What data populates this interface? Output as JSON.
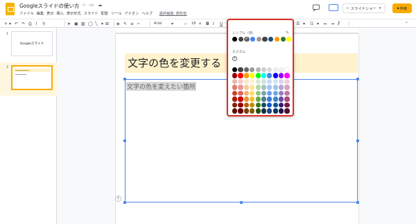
{
  "header": {
    "doc_title": "Googleスライドの使い方",
    "menu": [
      "ファイル",
      "編集",
      "表示",
      "挿入",
      "表示形式",
      "スライド",
      "配置",
      "ツール",
      "アドオン",
      "ヘルプ"
    ],
    "last_edit": "最終編集: 数秒前",
    "slideshow_label": "スライドショー",
    "share_label": "共有",
    "share_color": "#f9ab00"
  },
  "toolbar": {
    "font": "Arial",
    "font_size": "18",
    "text_color_glyph": "A"
  },
  "filmstrip": {
    "slides": [
      {
        "number": "1",
        "title": "Googleスライド"
      },
      {
        "number": "2",
        "title": "文字の色を変更する"
      }
    ]
  },
  "slide": {
    "title": "文字の色を変更する",
    "body": "文字の色を変えたい箇所",
    "title_bg": "#fff2cc"
  },
  "color_picker": {
    "simple_label": "シンプル（単）",
    "pastel_label": "カスタム",
    "simple_colors": [
      "#000000",
      "#434343",
      "#666666",
      "#4285f4",
      "#999999",
      "#434343",
      "#1f4e79",
      "#ff9900",
      "#38761d",
      "#ffff00"
    ],
    "grid_colors": [
      [
        "#000000",
        "#434343",
        "#666666",
        "#999999",
        "#b7b7b7",
        "#cccccc",
        "#d9d9d9",
        "#efefef",
        "#f3f3f3",
        "#ffffff"
      ],
      [
        "#980000",
        "#ff0000",
        "#ff9900",
        "#ffff00",
        "#00ff00",
        "#00ffff",
        "#4a86e8",
        "#0000ff",
        "#9900ff",
        "#ff00ff"
      ],
      [
        "#e6b8af",
        "#f4cccc",
        "#fce5cd",
        "#fff2cc",
        "#d9ead3",
        "#d0e0e3",
        "#c9daf8",
        "#cfe2f3",
        "#d9d2e9",
        "#ead1dc"
      ],
      [
        "#dd7e6b",
        "#ea9999",
        "#f9cb9c",
        "#ffe599",
        "#b6d7a8",
        "#a2c4c9",
        "#a4c2f4",
        "#9fc5e8",
        "#b4a7d6",
        "#d5a6bd"
      ],
      [
        "#cc4125",
        "#e06666",
        "#f6b26b",
        "#ffd966",
        "#93c47d",
        "#76a5af",
        "#6d9eeb",
        "#6fa8dc",
        "#8e7cc3",
        "#c27ba0"
      ],
      [
        "#a61c00",
        "#cc0000",
        "#e69138",
        "#f1c232",
        "#6aa84f",
        "#45818e",
        "#3c78d8",
        "#3d85c6",
        "#674ea7",
        "#a64d79"
      ],
      [
        "#85200c",
        "#990000",
        "#b45f06",
        "#bf9000",
        "#38761d",
        "#134f5c",
        "#1155cc",
        "#0b5394",
        "#351c75",
        "#741b47"
      ],
      [
        "#5b0f00",
        "#660000",
        "#783f04",
        "#7f6000",
        "#274e13",
        "#0c343d",
        "#1c4587",
        "#073763",
        "#20124d",
        "#4c1130"
      ]
    ],
    "highlight_color": "#d93025"
  }
}
